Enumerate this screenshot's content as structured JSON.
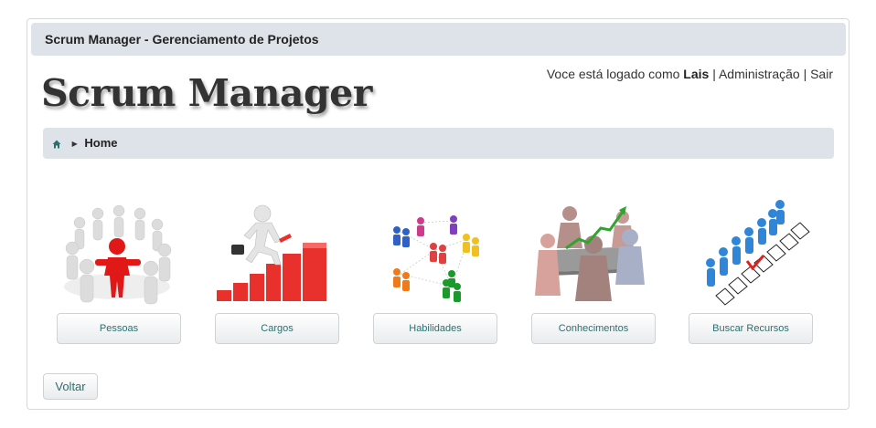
{
  "window": {
    "title": "Scrum Manager - Gerenciamento de Projetos"
  },
  "logo": {
    "text": "Scrum Manager"
  },
  "user_bar": {
    "prefix": "Voce está logado como",
    "user": "Lais",
    "sep1": "|",
    "admin_link": "Administração",
    "sep2": "|",
    "logout_link": "Sair"
  },
  "breadcrumb": {
    "current": "Home",
    "icon": "home-icon"
  },
  "tiles": [
    {
      "label": "Pessoas",
      "icon": "people-circle-image"
    },
    {
      "label": "Cargos",
      "icon": "career-stairs-image"
    },
    {
      "label": "Habilidades",
      "icon": "network-people-image"
    },
    {
      "label": "Conhecimentos",
      "icon": "meeting-growth-image"
    },
    {
      "label": "Buscar Recursos",
      "icon": "checklist-people-image"
    }
  ],
  "footer": {
    "back_label": "Voltar"
  },
  "colors": {
    "bar_bg": "#dde3e8",
    "link_teal": "#2c6f6f",
    "accent_red": "#e02020"
  }
}
